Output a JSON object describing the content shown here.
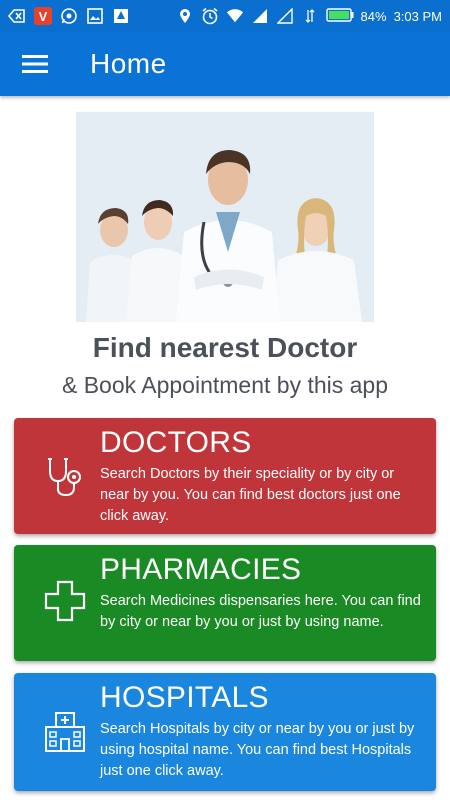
{
  "status_bar": {
    "battery": "84%",
    "time": "3:03 PM",
    "icons": [
      "back-arrow-icon",
      "vivaldi-icon",
      "whatsapp-icon",
      "gallery-icon",
      "drive-icon",
      "location-icon",
      "alarm-icon",
      "wifi-icon",
      "signal-icon",
      "signal-icon",
      "data-icon",
      "battery-icon"
    ]
  },
  "appbar": {
    "title": "Home"
  },
  "hero": {
    "image": "group-of-doctors-photo"
  },
  "headline": "Find nearest Doctor",
  "subheadline": "& Book Appointment by this app",
  "cards": [
    {
      "title": "DOCTORS",
      "description": "Search Doctors by their speciality or by city or near by you. You can find best doctors just one click away.",
      "icon": "stethoscope-icon",
      "color": "#c0353a"
    },
    {
      "title": "PHARMACIES",
      "description": "Search Medicines dispensaries here. You can find by city or near by you or just by using name.",
      "icon": "medical-cross-icon",
      "color": "#1a8a24"
    },
    {
      "title": "HOSPITALS",
      "description": "Search Hospitals by city or near by you or just by using hospital name. You can find best Hospitals just one click away.",
      "icon": "hospital-building-icon",
      "color": "#1a86dd"
    }
  ]
}
